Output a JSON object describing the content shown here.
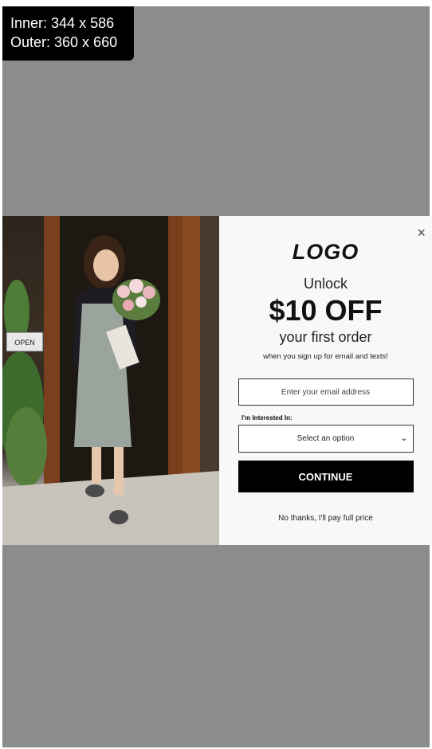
{
  "viewport_badge": {
    "inner": "Inner: 344 x 586",
    "outer": "Outer: 360 x 660"
  },
  "popup": {
    "logo": "LOGO",
    "unlock": "Unlock",
    "offer": "$10 OFF",
    "subheadline": "your first order",
    "fine_print": "when you sign up for email and texts!",
    "email_placeholder": "Enter your email address",
    "interest_label": "I'm Interested In:",
    "select_value": "Select an option",
    "continue_label": "CONTINUE",
    "decline_label": "No thanks, I'll pay full price",
    "close_icon": "×",
    "shop_sign": "OPEN"
  },
  "colors": {
    "backdrop": "#8c8c8c",
    "button": "#000000",
    "panel": "#f8f8f8"
  }
}
